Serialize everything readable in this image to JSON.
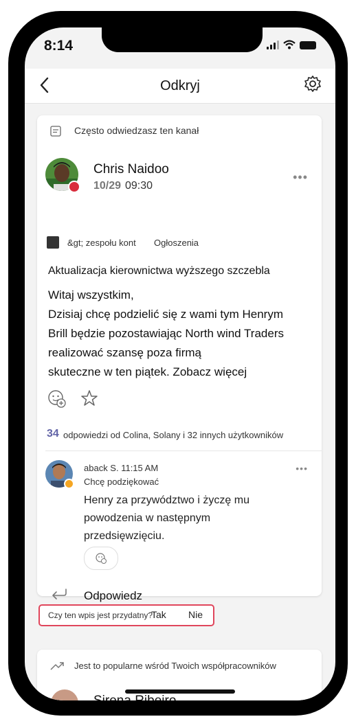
{
  "status_bar": {
    "time": "8:14"
  },
  "nav": {
    "title": "Odkryj"
  },
  "card": {
    "context": "Często odwiedzasz ten kanał",
    "author": "Chris Naidoo",
    "date": "10/29",
    "time": "09:30",
    "channel": "&gt; zespołu kont",
    "channel_name": "Ogłoszenia",
    "subject": "Aktualizacja kierownictwa wyższego szczebla",
    "body_lines": [
      "Witaj wszystkim,",
      "Dzisiaj chcę podzielić się z wami tym Henrym",
      "Brill będzie pozostawiając North wind Traders",
      "realizować szansę poza firmą",
      "skuteczne w ten piątek. Zobacz więcej"
    ],
    "replies_count": "34",
    "replies_text": "odpowiedzi od Colina, Solany i 32 innych użytkowników",
    "reply": {
      "author_time": "aback S. 11:15 AM",
      "line1": "Chcę podziękować",
      "lines": [
        "Henry za przywództwo i życzę mu",
        "powodzenia w następnym",
        "przedsięwzięciu."
      ]
    },
    "reply_action": "Odpowiedz"
  },
  "feedback": {
    "question": "Czy ten wpis jest przydatny?",
    "yes": "Tak",
    "no": "Nie",
    "border_color": "#e0455b"
  },
  "card2": {
    "context": "Jest to popularne wśród Twoich współpracowników",
    "author": "Sirena Ribeiro"
  },
  "colors": {
    "accent": "#6264a7",
    "presence_busy": "#d92c3c",
    "presence_away": "#f5a623"
  }
}
